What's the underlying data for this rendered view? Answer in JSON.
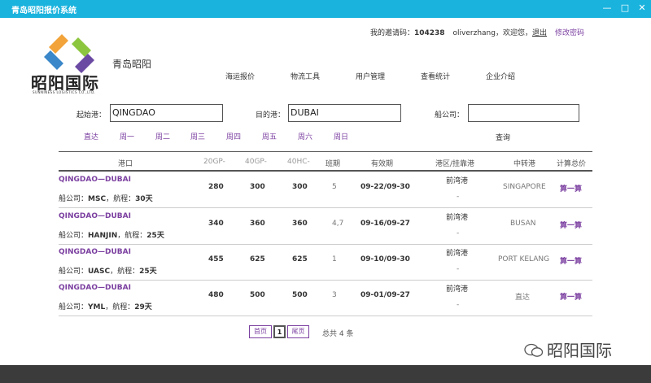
{
  "window": {
    "title": "青岛昭阳报价系统"
  },
  "userbar": {
    "invite_label": "我的邀请码：",
    "invite_code": "104238",
    "greeting": "oliverzhang，欢迎您，",
    "logout": "退出",
    "change_password": "修改密码"
  },
  "brand": {
    "logo_text": "昭阳国际",
    "logo_sub": "SUNNINESS LOGISTICS CO.,LTD.",
    "company": "青岛昭阳"
  },
  "nav": [
    "海运报价",
    "物流工具",
    "用户管理",
    "查看统计",
    "企业介绍"
  ],
  "search": {
    "origin_label": "起始港：",
    "origin_value": "QINGDAO",
    "dest_label": "目的港：",
    "dest_value": "DUBAI",
    "carrier_label": "船公司：",
    "carrier_value": "",
    "query_label": "查询"
  },
  "days": [
    "直达",
    "周一",
    "周二",
    "周三",
    "周四",
    "周五",
    "周六",
    "周日"
  ],
  "table": {
    "headers": [
      "港口",
      "20GP-",
      "40GP-",
      "40HC-",
      "班期",
      "有效期",
      "港区/挂靠港",
      "中转港",
      "计算总价"
    ],
    "rows": [
      {
        "route": "QINGDAO—DUBAI",
        "carrier_prefix": "船公司：",
        "carrier": "MSC",
        "voyage_prefix": "，航程：",
        "voyage": "30天",
        "gp20": "280",
        "gp40": "300",
        "hc40": "300",
        "schedule": "5",
        "validity": "09-22/09-30",
        "port": "前湾港",
        "dash": "-",
        "transit": "SINGAPORE",
        "calc": "算一算"
      },
      {
        "route": "QINGDAO—DUBAI",
        "carrier_prefix": "船公司：",
        "carrier": "HANJIN",
        "voyage_prefix": "，航程：",
        "voyage": "25天",
        "gp20": "340",
        "gp40": "360",
        "hc40": "360",
        "schedule": "4,7",
        "validity": "09-16/09-27",
        "port": "前湾港",
        "dash": "-",
        "transit": "BUSAN",
        "calc": "算一算"
      },
      {
        "route": "QINGDAO—DUBAI",
        "carrier_prefix": "船公司：",
        "carrier": "UASC",
        "voyage_prefix": "，航程：",
        "voyage": "25天",
        "gp20": "455",
        "gp40": "625",
        "hc40": "625",
        "schedule": "1",
        "validity": "09-10/09-30",
        "port": "前湾港",
        "dash": "-",
        "transit": "PORT KELANG",
        "calc": "算一算"
      },
      {
        "route": "QINGDAO—DUBAI",
        "carrier_prefix": "船公司：",
        "carrier": "YML",
        "voyage_prefix": "，航程：",
        "voyage": "29天",
        "gp20": "480",
        "gp40": "500",
        "hc40": "500",
        "schedule": "3",
        "validity": "09-01/09-27",
        "port": "前湾港",
        "dash": "-",
        "transit": "直达",
        "calc": "算一算"
      }
    ]
  },
  "pager": {
    "first": "首页",
    "current": "1",
    "last": "尾页",
    "total": "总共 4 条"
  },
  "watermark": "昭阳国际",
  "colors": {
    "titlebar": "#1ab3de",
    "accent": "#7b3fa0",
    "bottombar": "#3b3b3b"
  }
}
